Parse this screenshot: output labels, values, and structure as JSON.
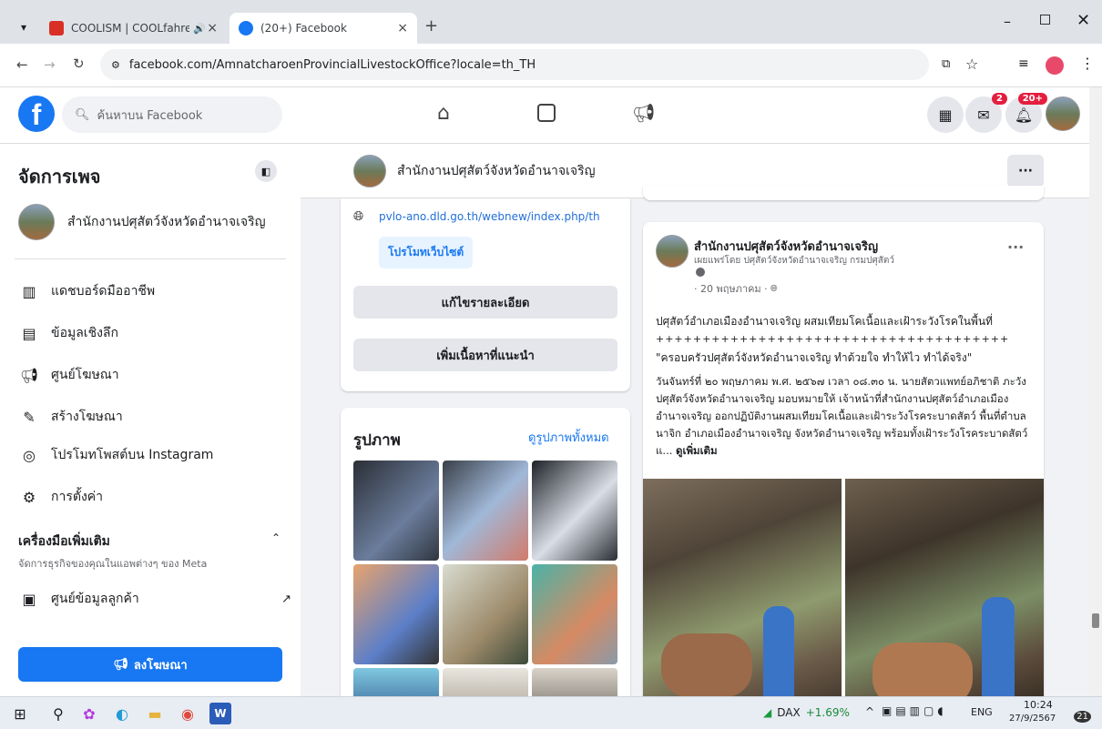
{
  "browser": {
    "tabs": [
      {
        "title": "COOLISM | COOLfahrenhe"
      },
      {
        "title": "(20+) Facebook"
      }
    ],
    "url": "facebook.com/AmnatcharoenProvincialLivestockOffice?locale=th_TH"
  },
  "fb": {
    "search_placeholder": "ค้นหาบน Facebook",
    "messenger_badge": "2",
    "notif_badge": "20+"
  },
  "sidebar": {
    "title": "จัดการเพจ",
    "page_name": "สำนักงานปศุสัตว์จังหวัดอำนาจเจริญ",
    "items": [
      {
        "label": "แดชบอร์ดมืออาชีพ",
        "icon": "dashboard-icon"
      },
      {
        "label": "ข้อมูลเชิงลึก",
        "icon": "insights-icon"
      },
      {
        "label": "ศูนย์โฆษณา",
        "icon": "megaphone-icon"
      },
      {
        "label": "สร้างโฆษณา",
        "icon": "edit-icon"
      },
      {
        "label": "โปรโมทโพสต์บน Instagram",
        "icon": "instagram-icon"
      },
      {
        "label": "การตั้งค่า",
        "icon": "gear-icon"
      }
    ],
    "tools_title": "เครื่องมือเพิ่มเติม",
    "tools_sub": "จัดการธุรกิจของคุณในแอพต่างๆ ของ Meta",
    "customer_center": "ศูนย์ข้อมูลลูกค้า",
    "ad_button": "ลงโฆษณา"
  },
  "main": {
    "page_name": "สำนักงานปศุสัตว์จังหวัดอำนาจเจริญ",
    "website": "pvlo-ano.dld.go.th/webnew/index.php/th",
    "promote_website": "โปรโมทเว็บไซต์",
    "edit_details": "แก้ไขรายละเอียด",
    "add_featured": "เพิ่มเนื้อหาที่แนะนำ",
    "photos_title": "รูปภาพ",
    "see_all_photos": "ดูรูปภาพทั้งหมด"
  },
  "post": {
    "author": "สำนักงานปศุสัตว์จังหวัดอำนาจเจริญ",
    "published_by": "เผยแพร่โดย ปศุสัตว์จังหวัดอำนาจเจริญ กรมปศุสัตว์",
    "date": "· 20 พฤษภาคม ·",
    "line1": "ปศุสัตว์อำเภอเมืองอำนาจเจริญ ผสมเทียมโคเนื้อและเฝ้าระวังโรคในพื้นที่",
    "line2": "++++++++++++++++++++++++++++++++++++++",
    "line3": "\"ครอบครัวปศุสัตว์จังหวัดอำนาจเจริญ ทำด้วยใจ ทำให้ไว ทำได้จริง\"",
    "body": "วันจันทร์ที่ ๒๐ พฤษภาคม พ.ศ. ๒๕๖๗ เวลา ๐๘.๓๐ น. นายสัตวแพทย์อภิชาติ ภะวัง ปศุสัตว์จังหวัดอำนาจเจริญ มอบหมายให้ เจ้าหน้าที่สำนักงานปศุสัตว์อำเภอเมืองอำนาจเจริญ ออกปฏิบัติงานผสมเทียมโคเนื้อและเฝ้าระวังโรคระบาดสัตว์ พื้นที่ตำบลนาจิก อำเภอเมืองอำนาจเจริญ จังหวัดอำนาจเจริญ พร้อมทั้งเฝ้าระวังโรคระบาดสัตว์ แ...",
    "see_more": "ดูเพิ่มเติม"
  },
  "taskbar": {
    "stock": "DAX",
    "stock_change": "+1.69%",
    "lang": "ENG",
    "time": "10:24",
    "date": "27/9/2567",
    "notif": "21"
  }
}
